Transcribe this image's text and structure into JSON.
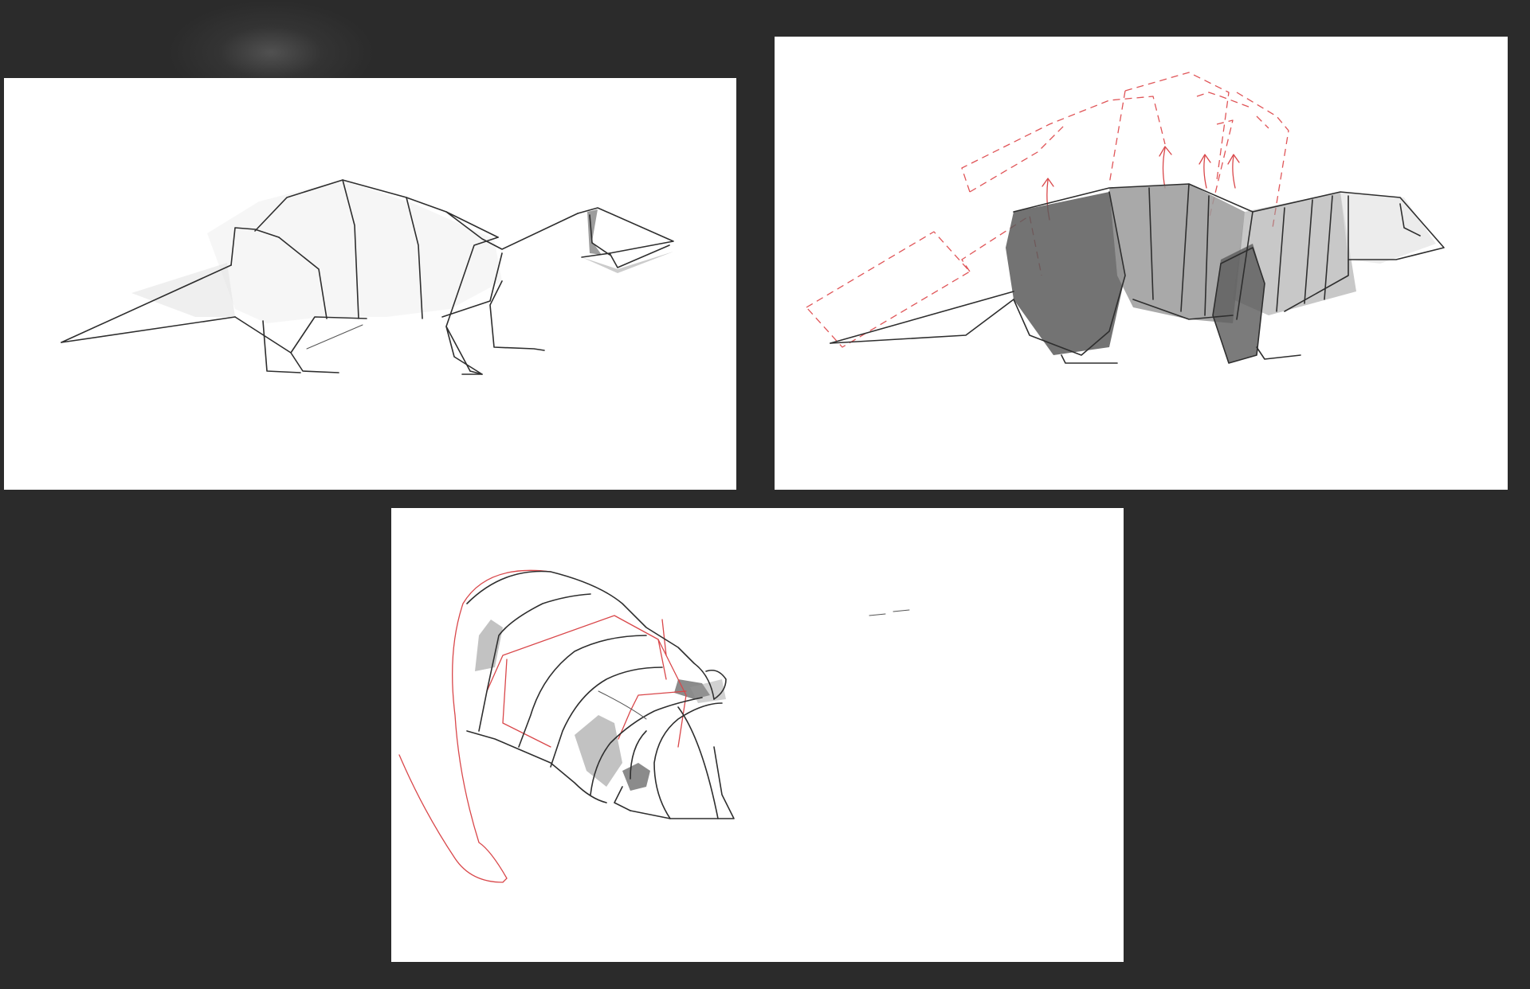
{
  "canvas": {
    "background": "#2b2b2b",
    "panel_background": "#ffffff"
  },
  "panels": [
    {
      "subject": "origami-otter-sketch",
      "ink": "#2e2e2e"
    },
    {
      "subject": "origami-otter-shaded-study",
      "ink": "#2e2e2e",
      "accent": "#e05558"
    },
    {
      "subject": "origami-otter-head-perspective",
      "ink": "#2e2e2e",
      "accent": "#d9474a"
    }
  ]
}
